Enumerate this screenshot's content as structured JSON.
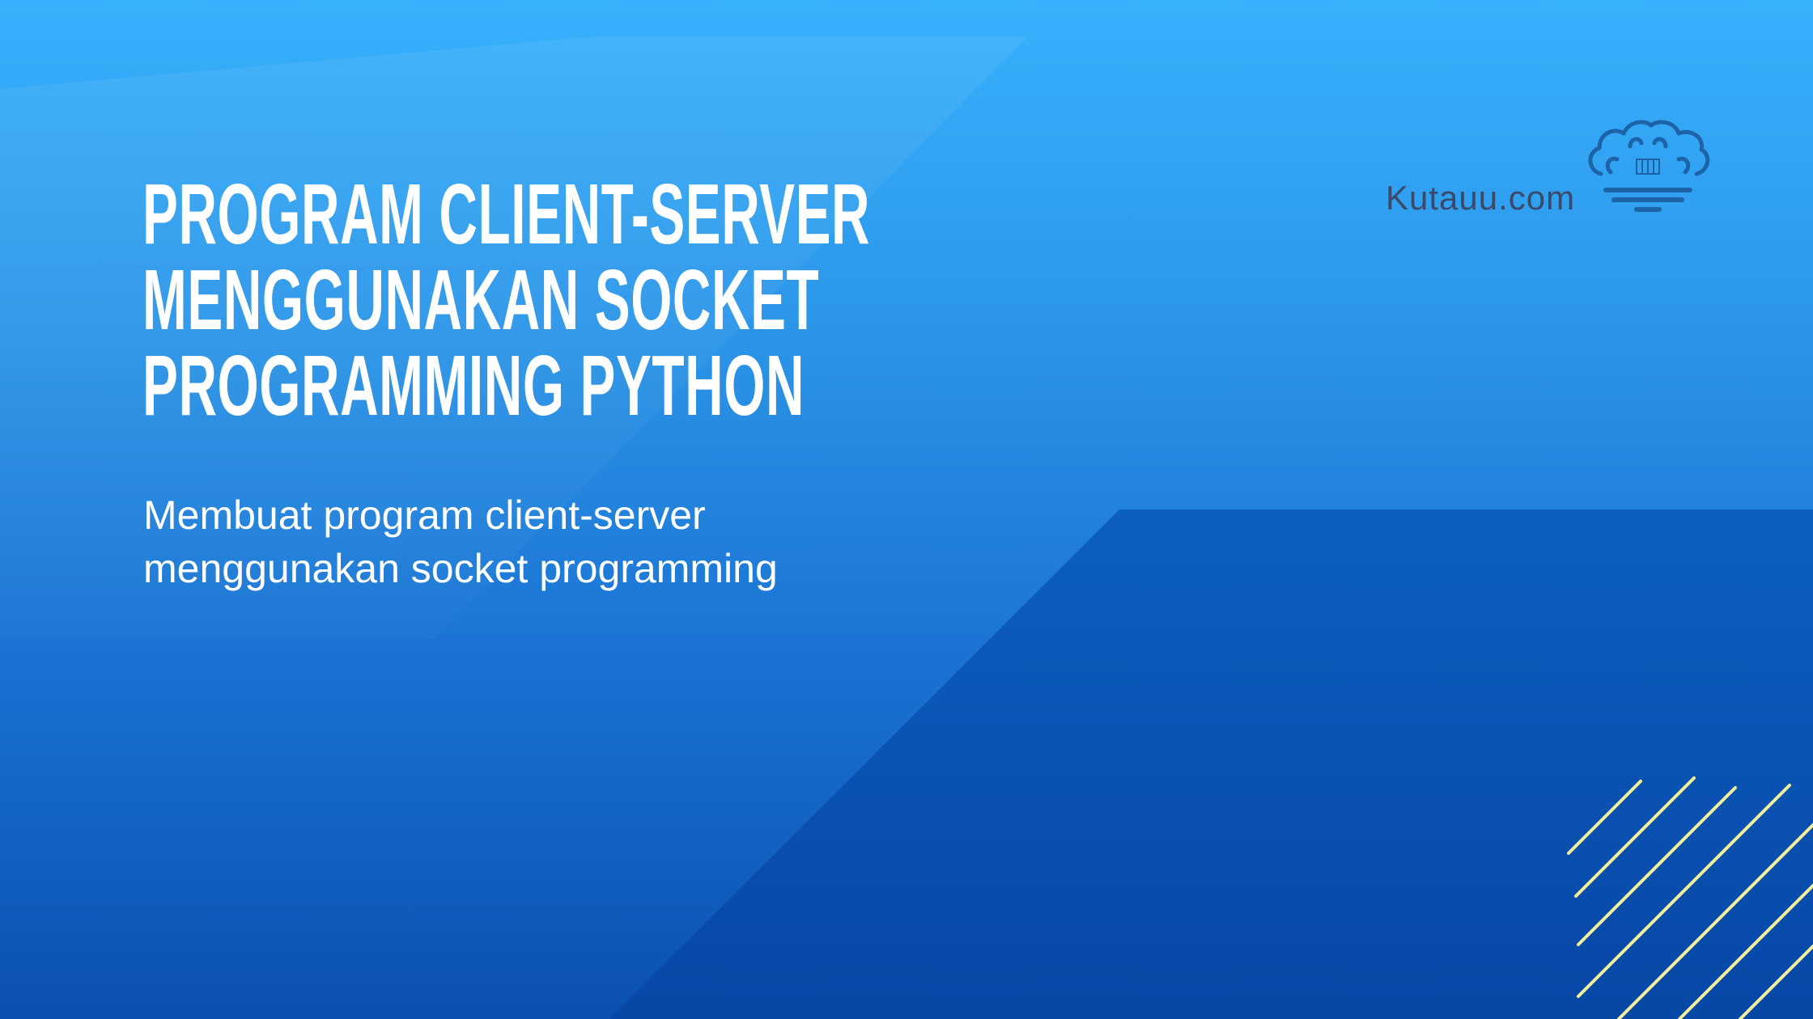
{
  "headline": {
    "line1": "PROGRAM CLIENT-SERVER",
    "line2": "MENGGUNAKAN SOCKET",
    "line3": "PROGRAMMING PYTHON"
  },
  "subtitle": {
    "line1": "Membuat program client-server",
    "line2": "menggunakan socket programming"
  },
  "brand": {
    "name": "Kutauu.com",
    "logo_icon": "cloud-logo-icon"
  },
  "colors": {
    "background_top": "#38b1fd",
    "background_bottom": "#0b50b0",
    "text": "#ffffff",
    "brand_text": "#3b4a6b",
    "logo": "#1c63a8",
    "stripes": "#f2ee9a"
  }
}
